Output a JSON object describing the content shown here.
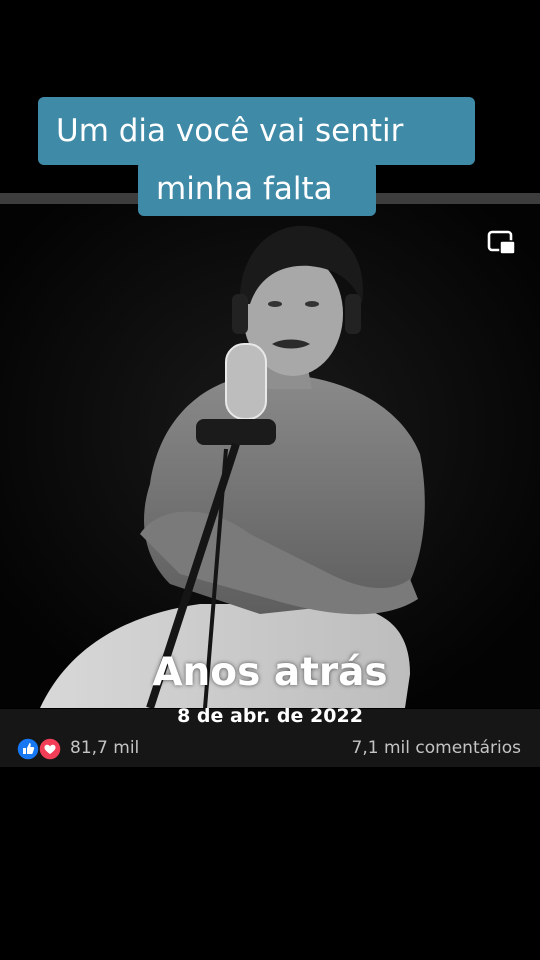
{
  "caption": {
    "line1": "Um dia você vai sentir",
    "line2": "minha falta"
  },
  "memory": {
    "title": "Anos atrás",
    "date": "8 de abr. de 2022"
  },
  "reactions": {
    "icons": [
      "like-icon",
      "love-icon"
    ],
    "count": "81,7 mil",
    "comments": "7,1 mil comentários"
  },
  "colors": {
    "caption_bg": "#3f8aa7",
    "like": "#1877f2",
    "love": "#f33e58"
  }
}
